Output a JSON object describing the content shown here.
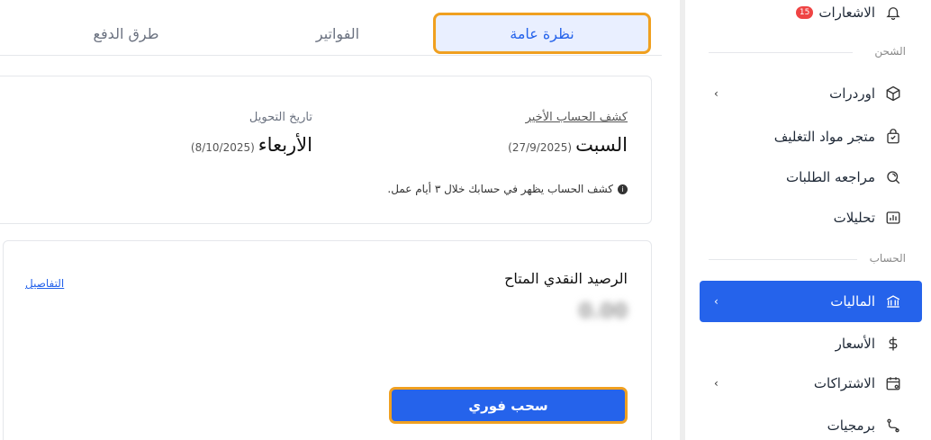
{
  "sidebar": {
    "notifications": {
      "label": "الاشعارات",
      "badge": "15"
    },
    "section_shipping": "الشحن",
    "items_shipping": [
      {
        "label": "اوردرات",
        "icon": "box-icon",
        "has_chevron": true
      },
      {
        "label": "متجر مواد التغليف",
        "icon": "shopping-bag-icon",
        "has_chevron": false
      },
      {
        "label": "مراجعه الطلبات",
        "icon": "review-search-icon",
        "has_chevron": false
      },
      {
        "label": "تحليلات",
        "icon": "analytics-chart-icon",
        "has_chevron": false
      }
    ],
    "section_account": "الحساب",
    "items_account": [
      {
        "label": "الماليات",
        "icon": "bank-icon",
        "has_chevron": true,
        "active": true
      },
      {
        "label": "الأسعار",
        "icon": "dollar-icon",
        "has_chevron": false
      },
      {
        "label": "الاشتراكات",
        "icon": "calendar-icon",
        "has_chevron": true
      },
      {
        "label": "برمجيات",
        "icon": "api-icon",
        "has_chevron": false
      }
    ],
    "accent_color": "#2563eb"
  },
  "tabs": [
    {
      "label": "نظرة عامة",
      "active": true
    },
    {
      "label": "الفواتير",
      "active": false
    },
    {
      "label": "طرق الدفع",
      "active": false
    }
  ],
  "statement": {
    "last_statement_label": "كشف الحساب الأخير",
    "last_statement_day": "السبت",
    "last_statement_date": "(27/9/2025)",
    "transfer_date_label": "تاريخ التحويل",
    "transfer_day": "الأربعاء",
    "transfer_date": "(8/10/2025)",
    "info_note": "كشف الحساب يظهر في حسابك خلال ٣ أيام عمل."
  },
  "balance": {
    "title": "الرصيد النقدي المتاح",
    "amount": "0.00",
    "details_link": "التفاصيل",
    "withdraw_button": "سحب فوري"
  }
}
